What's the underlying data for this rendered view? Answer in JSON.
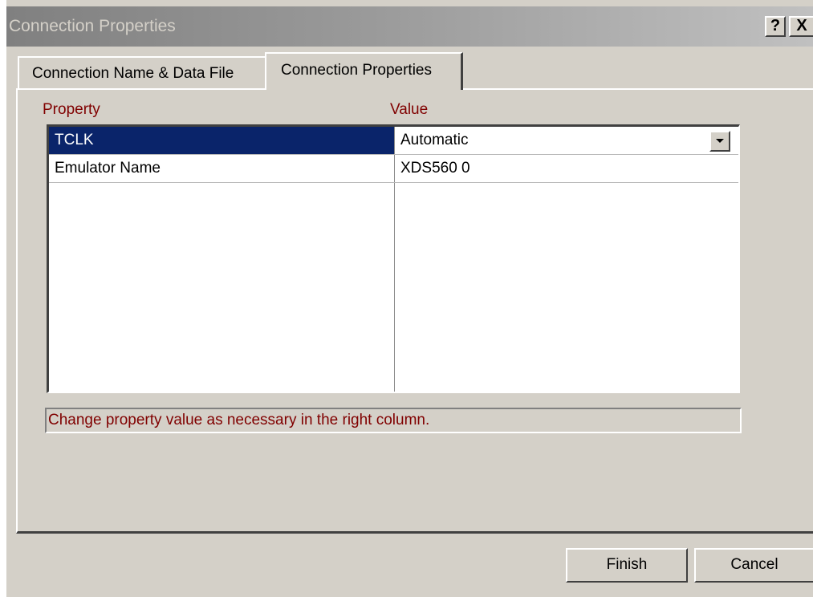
{
  "window": {
    "title": "Connection Properties",
    "help_button": "?",
    "close_button": "X"
  },
  "tabs": [
    {
      "label": "Connection Name & Data File",
      "active": false
    },
    {
      "label": "Connection Properties",
      "active": true
    }
  ],
  "grid": {
    "headers": {
      "property": "Property",
      "value": "Value"
    },
    "rows": [
      {
        "property": "TCLK",
        "value": "Automatic",
        "selected": true,
        "has_dropdown": true
      },
      {
        "property": "Emulator Name",
        "value": "XDS560 0",
        "selected": false,
        "has_dropdown": false
      }
    ]
  },
  "hint": "Change property value as necessary in the right column.",
  "buttons": {
    "finish": "Finish",
    "cancel": "Cancel"
  },
  "colors": {
    "selection": "#0a246a",
    "hint_text": "#800000",
    "dialog_face": "#d4d0c8"
  }
}
